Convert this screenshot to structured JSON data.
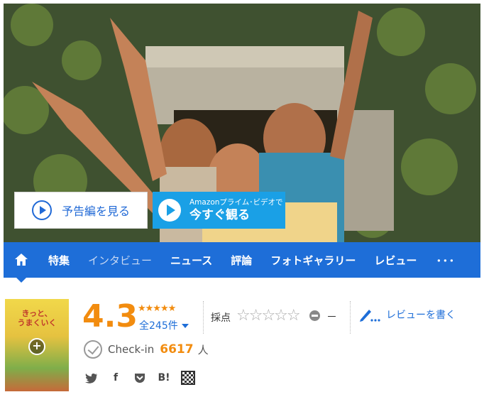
{
  "hero": {
    "trailer_label": "予告編を見る",
    "amazon_small": "Amazonプライム･ビデオで",
    "amazon_big": "今すぐ観る"
  },
  "nav": {
    "items": [
      "特集",
      "インタビュー",
      "ニュース",
      "評論",
      "フォトギャラリー",
      "レビュー"
    ],
    "more": "･･･"
  },
  "poster": {
    "title_line1": "きっと、",
    "title_line2": "うまくいく"
  },
  "rating": {
    "score": "4.3",
    "stars": "★★★★★",
    "count": "全245件",
    "grade_label": "採点",
    "empty_stars": "☆☆☆☆☆",
    "grade_value": "－"
  },
  "review": {
    "label": "レビューを書く"
  },
  "checkin": {
    "label": "Check-in",
    "count": "6617",
    "unit": "人"
  },
  "share": {
    "facebook": "f",
    "hatena": "B!"
  },
  "colors": {
    "accent": "#1e6ed8",
    "score": "#f28c0f",
    "amazon": "#1aa0e6"
  }
}
